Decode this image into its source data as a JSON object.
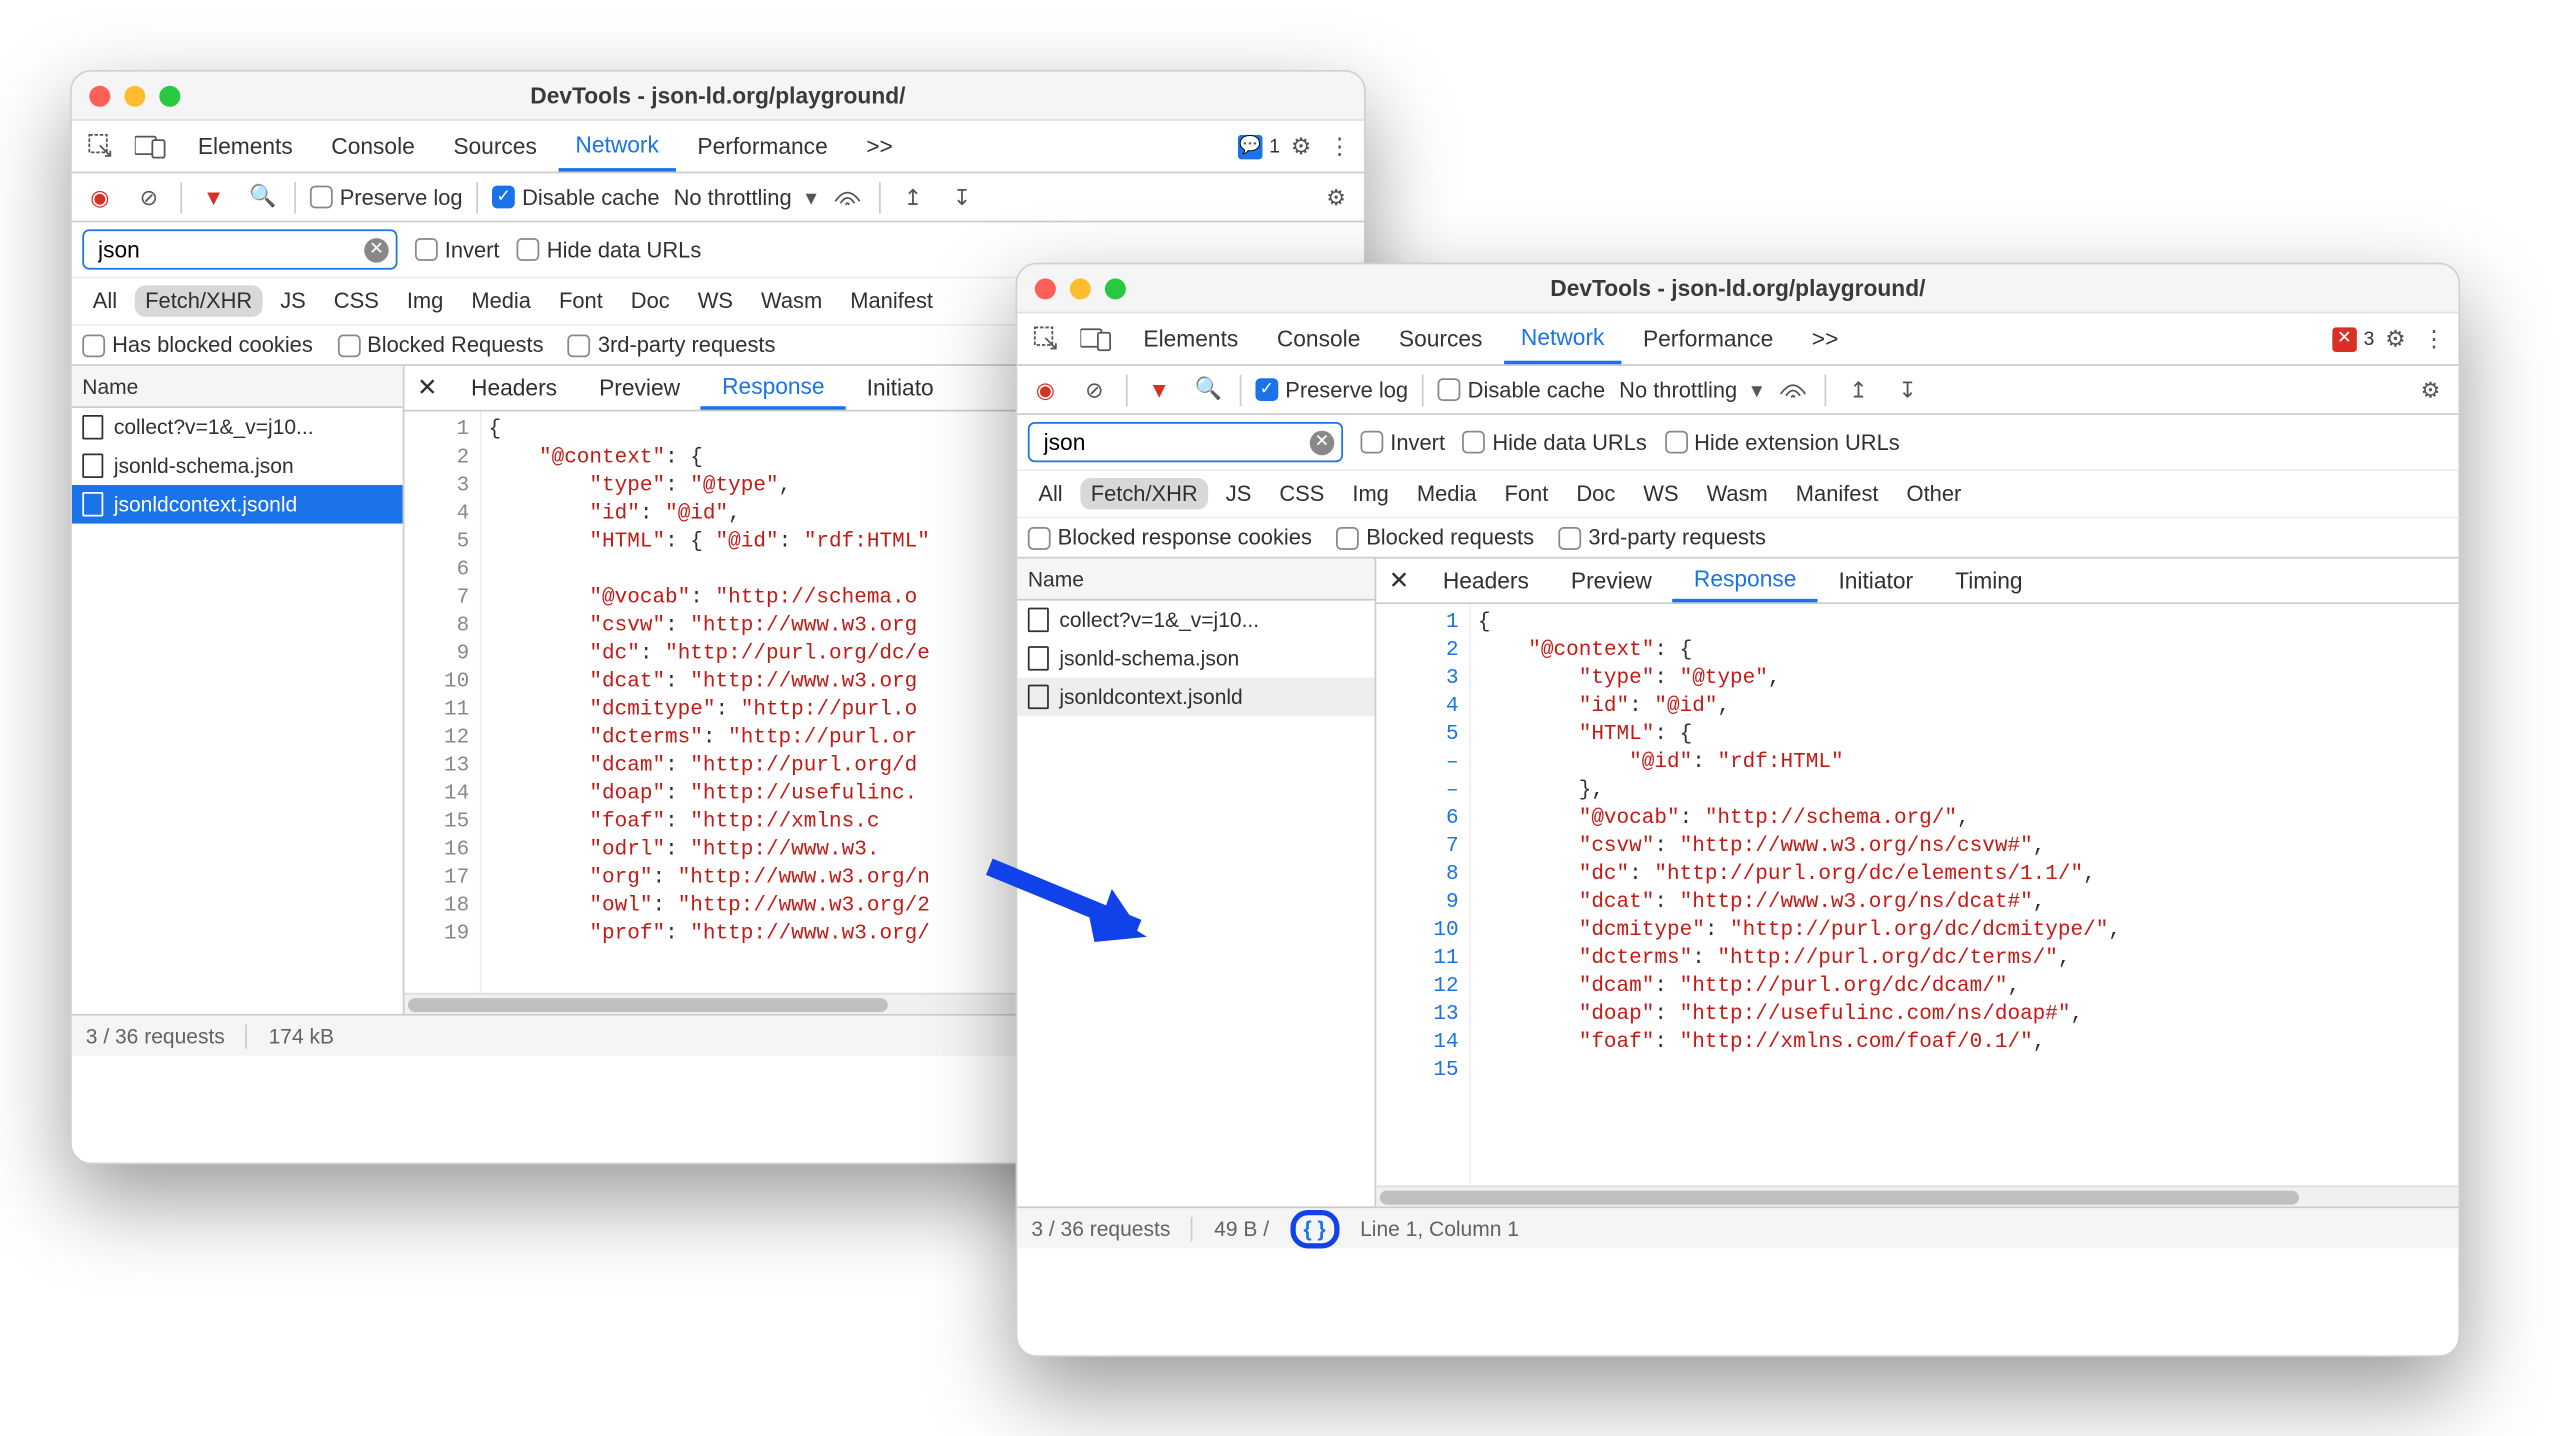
{
  "shared": {
    "window_title": "DevTools - json-ld.org/playground/",
    "tabs": [
      "Elements",
      "Console",
      "Sources",
      "Network",
      "Performance"
    ],
    "more_glyph": ">>",
    "filter_value": "json",
    "invert_label": "Invert",
    "hidedata_label": "Hide data URLs",
    "hideext_label": "Hide extension URLs",
    "types": [
      "All",
      "Fetch/XHR",
      "JS",
      "CSS",
      "Img",
      "Media",
      "Font",
      "Doc",
      "WS",
      "Wasm",
      "Manifest"
    ],
    "other_label": "Other",
    "name_header": "Name",
    "detail_tabs": [
      "Headers",
      "Preview",
      "Response",
      "Initiator",
      "Timing"
    ],
    "requests": [
      {
        "name": "collect?v=1&_v=j10..."
      },
      {
        "name": "jsonld-schema.json"
      },
      {
        "name": "jsonldcontext.jsonld"
      }
    ],
    "preservelog_label": "Preserve log",
    "disablecache_label": "Disable cache",
    "throttle_label": "No throttling",
    "req_count": "3 / 36 requests"
  },
  "win1": {
    "issue_count": "1",
    "extras": [
      "Has blocked cookies",
      "Blocked Requests",
      "3rd-party requests"
    ],
    "gutter": [
      "1",
      "2",
      "3",
      "4",
      "5",
      "6",
      "7",
      "8",
      "9",
      "10",
      "11",
      "12",
      "13",
      "14",
      "15",
      "16",
      "17",
      "18",
      "19"
    ],
    "code_html": "{\n    <span class='s'>\"@context\"</span>: {\n        <span class='s'>\"type\"</span>: <span class='s'>\"@type\"</span>,\n        <span class='s'>\"id\"</span>: <span class='s'>\"@id\"</span>,\n        <span class='s'>\"HTML\"</span>: { <span class='s'>\"@id\"</span>: <span class='s'>\"rdf:HTML\"</span>\n\n        <span class='s'>\"@vocab\"</span>: <span class='s'>\"http://schema.o</span>\n        <span class='s'>\"csvw\"</span>: <span class='s'>\"http://www.w3.org</span>\n        <span class='s'>\"dc\"</span>: <span class='s'>\"http://purl.org/dc/e</span>\n        <span class='s'>\"dcat\"</span>: <span class='s'>\"http://www.w3.org</span>\n        <span class='s'>\"dcmitype\"</span>: <span class='s'>\"http://purl.o</span>\n        <span class='s'>\"dcterms\"</span>: <span class='s'>\"http://purl.or</span>\n        <span class='s'>\"dcam\"</span>: <span class='s'>\"http://purl.org/d</span>\n        <span class='s'>\"doap\"</span>: <span class='s'>\"http://usefulinc.</span>\n        <span class='s'>\"foaf\"</span>: <span class='s'>\"http://xmlns.c</span>\n        <span class='s'>\"odrl\"</span>: <span class='s'>\"http://www.w3.</span>\n        <span class='s'>\"org\"</span>: <span class='s'>\"http://www.w3.org/n</span>\n        <span class='s'>\"owl\"</span>: <span class='s'>\"http://www.w3.org/2</span>\n        <span class='s'>\"prof\"</span>: <span class='s'>\"http://www.w3.org/</span>",
    "size_label": "174 kB"
  },
  "win2": {
    "issue_count": "3",
    "extras": [
      "Blocked response cookies",
      "Blocked requests",
      "3rd-party requests"
    ],
    "gutter": [
      "1",
      "2",
      "3",
      "4",
      "5",
      "–",
      "–",
      "6",
      "7",
      "8",
      "9",
      "10",
      "11",
      "12",
      "13",
      "14",
      "15"
    ],
    "code_html": "{\n    <span class='s'>\"@context\"</span>: {\n        <span class='s'>\"type\"</span>: <span class='s'>\"@type\"</span>,\n        <span class='s'>\"id\"</span>: <span class='s'>\"@id\"</span>,\n        <span class='s'>\"HTML\"</span>: {\n            <span class='s'>\"@id\"</span>: <span class='s'>\"rdf:HTML\"</span>\n        },\n        <span class='s'>\"@vocab\"</span>: <span class='s'>\"http://schema.org/\"</span>,\n        <span class='s'>\"csvw\"</span>: <span class='s'>\"http://www.w3.org/ns/csvw#\"</span>,\n        <span class='s'>\"dc\"</span>: <span class='s'>\"http://purl.org/dc/elements/1.1/\"</span>,\n        <span class='s'>\"dcat\"</span>: <span class='s'>\"http://www.w3.org/ns/dcat#\"</span>,\n        <span class='s'>\"dcmitype\"</span>: <span class='s'>\"http://purl.org/dc/dcmitype/\"</span>,\n        <span class='s'>\"dcterms\"</span>: <span class='s'>\"http://purl.org/dc/terms/\"</span>,\n        <span class='s'>\"dcam\"</span>: <span class='s'>\"http://purl.org/dc/dcam/\"</span>,\n        <span class='s'>\"doap\"</span>: <span class='s'>\"http://usefulinc.com/ns/doap#\"</span>,\n        <span class='s'>\"foaf\"</span>: <span class='s'>\"http://xmlns.com/foaf/0.1/\"</span>,",
    "size_label": "49 B /",
    "pretty_glyph": "{ }",
    "position_label": "Line 1, Column 1"
  }
}
